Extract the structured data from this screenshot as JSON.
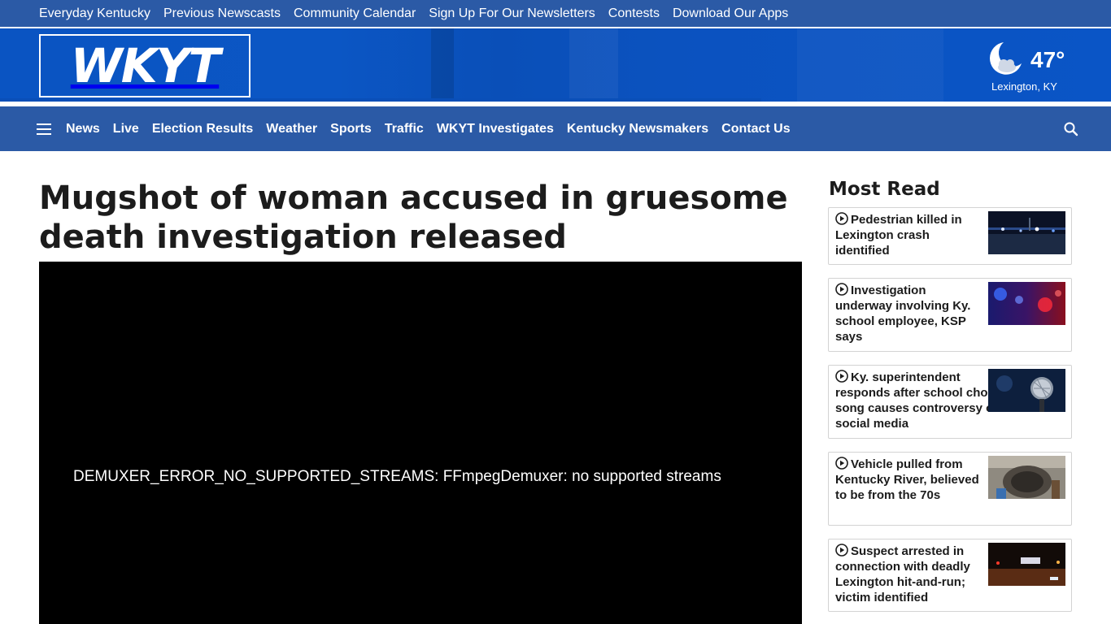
{
  "utility_nav": {
    "items": [
      {
        "label": "Everyday Kentucky"
      },
      {
        "label": "Previous Newscasts"
      },
      {
        "label": "Community Calendar"
      },
      {
        "label": "Sign Up For Our Newsletters"
      },
      {
        "label": "Contests"
      },
      {
        "label": "Download Our Apps"
      }
    ]
  },
  "logo": {
    "text": "WKYT"
  },
  "weather": {
    "temperature": "47°",
    "location": "Lexington, KY",
    "icon": "partly-cloudy-night-icon"
  },
  "main_nav": {
    "items": [
      {
        "label": "News"
      },
      {
        "label": "Live"
      },
      {
        "label": "Election Results"
      },
      {
        "label": "Weather"
      },
      {
        "label": "Sports"
      },
      {
        "label": "Traffic"
      },
      {
        "label": "WKYT Investigates"
      },
      {
        "label": "Kentucky Newsmakers"
      },
      {
        "label": "Contact Us"
      }
    ]
  },
  "article": {
    "headline": "Mugshot of woman accused in gruesome death investigation released",
    "video_error": "DEMUXER_ERROR_NO_SUPPORTED_STREAMS: FFmpegDemuxer: no supported streams"
  },
  "most_read": {
    "title": "Most Read",
    "items": [
      {
        "headline": "Pedestrian killed in Lexington crash identified",
        "thumb": "night-road-crash-scene"
      },
      {
        "headline": "Investigation underway involving Ky. school employee, KSP says",
        "thumb": "police-lights"
      },
      {
        "headline": "Ky. superintendent responds after school choir’s song causes controversy on social media",
        "thumb": "microphone"
      },
      {
        "headline": "Vehicle pulled from Kentucky River, believed to be from the 70s",
        "thumb": "rusted-vehicle"
      },
      {
        "headline": "Suspect arrested in connection with deadly Lexington hit-and-run; victim identified",
        "thumb": "night-street-scene"
      }
    ]
  },
  "colors": {
    "brand_blue": "#2b5aa6",
    "masthead_blue": "#0a54c2"
  }
}
